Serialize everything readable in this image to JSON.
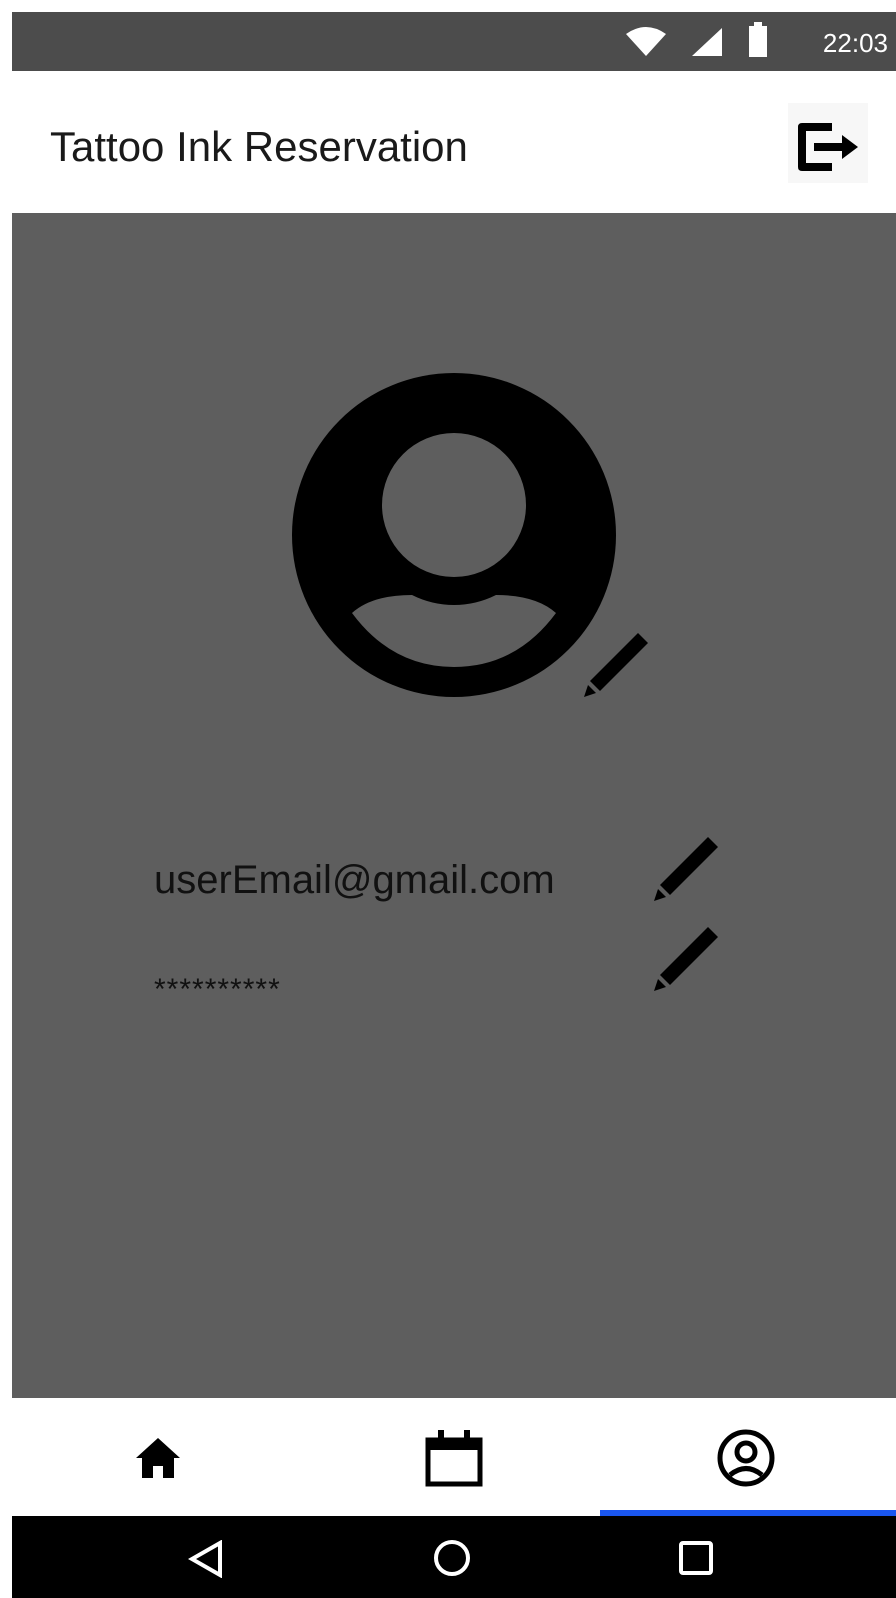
{
  "status_bar": {
    "time": "22:03",
    "icons": [
      "wifi-icon",
      "cell-signal-icon",
      "battery-icon"
    ]
  },
  "app_bar": {
    "title": "Tattoo Ink Reservation",
    "logout_icon": "logout-icon"
  },
  "profile": {
    "avatar_icon": "account-circle-icon",
    "email": "userEmail@gmail.com",
    "password_masked": "**********",
    "edit_icon": "pencil-icon"
  },
  "bottom_nav": {
    "items": [
      {
        "icon": "home-icon",
        "selected": false
      },
      {
        "icon": "calendar-icon",
        "selected": false
      },
      {
        "icon": "account-circle-icon",
        "selected": true
      }
    ],
    "indicator_color": "#1a56f0"
  },
  "system_nav": {
    "buttons": [
      "back-icon",
      "home-circle-icon",
      "recents-icon"
    ]
  },
  "colors": {
    "content_bg": "#5e5e5e",
    "status_bar_bg": "#4c4c4c",
    "app_bar_bg": "#ffffff",
    "system_nav_bg": "#000000"
  }
}
